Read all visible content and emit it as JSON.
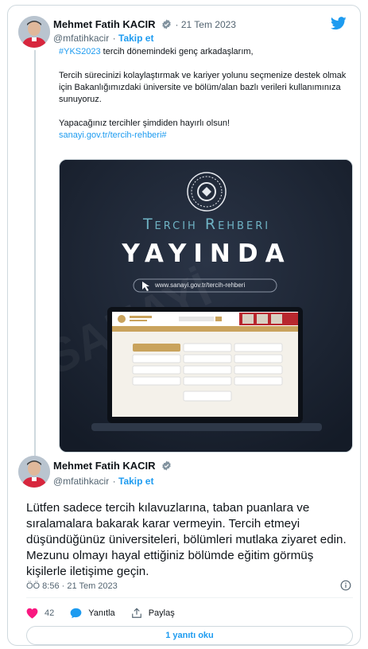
{
  "tweet1": {
    "author_name": "Mehmet Fatih KACIR",
    "date": "21 Tem 2023",
    "handle": "@mfatihkacir",
    "follow_label": "Takip et",
    "hashtag": "#YKS2023",
    "line1_rest": " tercih dönemindeki genç arkadaşlarım,",
    "para2": "Tercih sürecinizi kolaylaştırmak ve kariyer yolunu seçmenize destek olmak için Bakanlığımızdaki üniversite ve bölüm/alan bazlı verileri kullanımınıza sunuyoruz.",
    "para3": "Yapacağınız tercihler şimdiden hayırlı olsun!",
    "link": "sanayi.gov.tr/tercih-rehberi#"
  },
  "media": {
    "banner_title": "Tercih Rehberi",
    "banner_headline": "YAYINDA",
    "url_pill": "www.sanayi.gov.tr/tercih-rehberi",
    "colors": {
      "background": "#1a2230",
      "accent": "#6fb3c4",
      "gold": "#c9a35d"
    }
  },
  "tweet2": {
    "author_name": "Mehmet Fatih KACIR",
    "handle": "@mfatihkacir",
    "follow_label": "Takip et",
    "text": "Lütfen sadece tercih kılavuzlarına, taban puanlara ve sıralamalara bakarak karar vermeyin. Tercih etmeyi düşündüğünüz üniversiteleri, bölümleri mutlaka ziyaret edin. Mezunu olmayı hayal ettiğiniz bölümde eğitim görmüş kişilerle iletişime geçin.",
    "timestamp": "ÖÖ 8:56 · 21 Tem 2023",
    "like_count": "42",
    "reply_label": "Yanıtla",
    "share_label": "Paylaş",
    "read_replies_label": "1 yanıtı oku"
  },
  "icons": [
    "twitter-bird-icon",
    "verified-badge-icon",
    "info-icon",
    "heart-icon",
    "reply-bubble-icon",
    "share-icon",
    "cursor-arrow-icon"
  ]
}
